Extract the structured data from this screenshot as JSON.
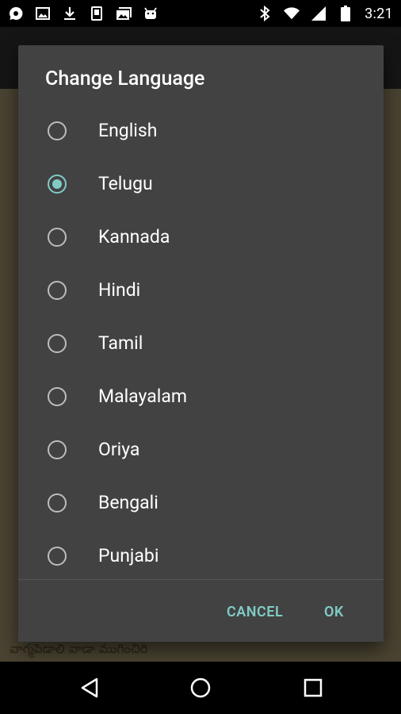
{
  "status_bar": {
    "left_icons": [
      "chat-bubble-icon",
      "image-icon",
      "download-icon",
      "phone-icon",
      "photo-album-icon",
      "android-icon"
    ],
    "right_icons": [
      "bluetooth-icon",
      "wifi-icon",
      "signal-icon",
      "battery-icon"
    ],
    "time": "3:21"
  },
  "background": {
    "bottom_text": "వాగ్మపెడాలి వాడా ముగించిరి"
  },
  "dialog": {
    "title": "Change Language",
    "options": [
      {
        "label": "English",
        "checked": false
      },
      {
        "label": "Telugu",
        "checked": true
      },
      {
        "label": "Kannada",
        "checked": false
      },
      {
        "label": "Hindi",
        "checked": false
      },
      {
        "label": "Tamil",
        "checked": false
      },
      {
        "label": "Malayalam",
        "checked": false
      },
      {
        "label": "Oriya",
        "checked": false
      },
      {
        "label": "Bengali",
        "checked": false
      },
      {
        "label": "Punjabi",
        "checked": false
      }
    ],
    "cancel_label": "CANCEL",
    "ok_label": "OK",
    "accent_color": "#80cbc4"
  },
  "nav_bar": {
    "icons": [
      "back-icon",
      "home-icon",
      "recents-icon"
    ]
  }
}
